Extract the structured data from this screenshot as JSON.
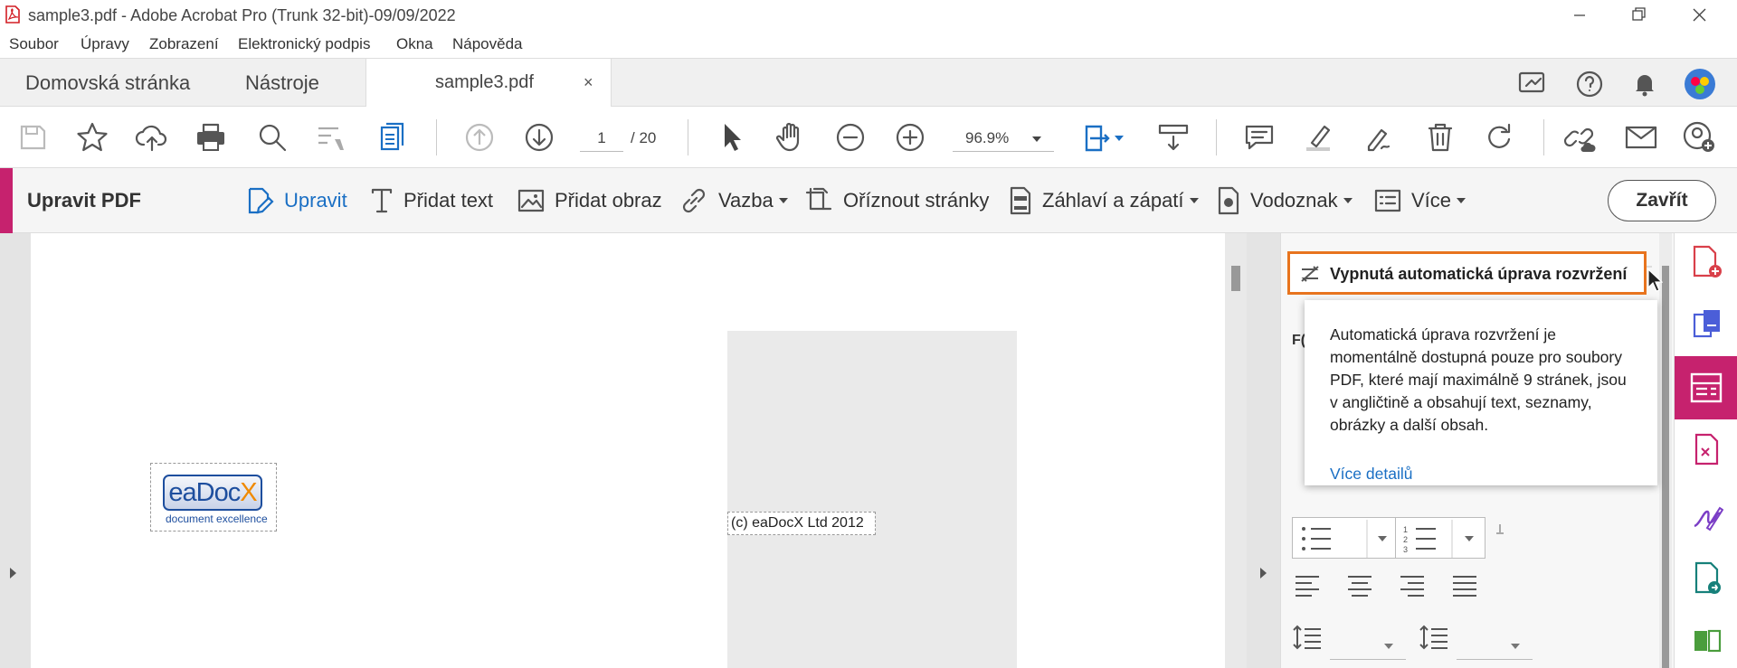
{
  "window": {
    "title": "sample3.pdf - Adobe Acrobat Pro (Trunk 32-bit)-09/09/2022"
  },
  "menu": [
    "Soubor",
    "Úpravy",
    "Zobrazení",
    "Elektronický podpis",
    "Okna",
    "Nápověda"
  ],
  "tabs": {
    "home": "Domovská stránka",
    "tools": "Nástroje",
    "document": "sample3.pdf",
    "close_glyph": "×"
  },
  "toolbar": {
    "page_current": "1",
    "page_total": "/ 20",
    "zoom": "96.9%"
  },
  "editbar": {
    "title": "Upravit PDF",
    "edit": "Upravit",
    "add_text": "Přidat text",
    "add_image": "Přidat obraz",
    "link": "Vazba",
    "crop": "Oříznout stránky",
    "header_footer": "Záhlaví a zápatí",
    "watermark": "Vodoznak",
    "more": "Více",
    "close": "Zavřít"
  },
  "document": {
    "logo_main": "eaDocX",
    "logo_x": "X",
    "logo_sub": "document excellence",
    "copyright": "(c) eaDocX Ltd 2012"
  },
  "panel": {
    "auto_reflow": "Vypnutá automatická úprava rozvržení",
    "tooltip_text": "Automatická úprava rozvržení je momentálně dostupná pouze pro soubory PDF, které mají maximálně 9 stránek, jsou v angličtině a obsahují text, seznamy, obrázky a další obsah.",
    "tooltip_link": "Více detailů",
    "partial_label": "F("
  },
  "colors": {
    "accent": "#c6226e",
    "link": "#1a6fc4",
    "highlight": "#e8741e"
  }
}
